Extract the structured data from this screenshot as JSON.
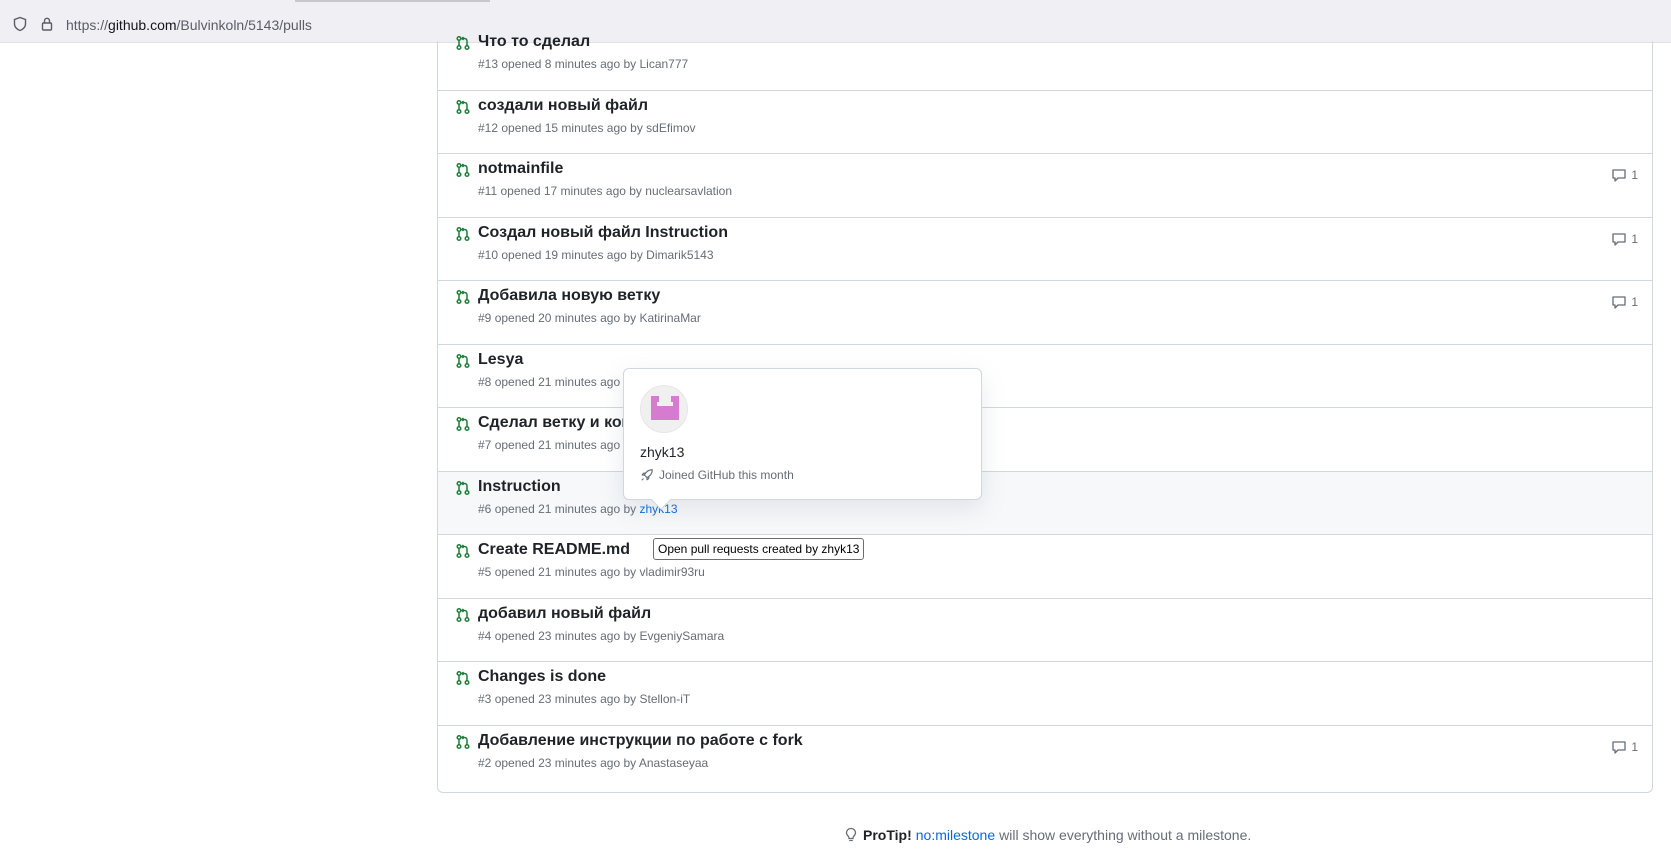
{
  "browser": {
    "url_prefix": "https://",
    "url_domain": "github.com",
    "url_path": "/Bulvinkoln/5143/pulls"
  },
  "pulls": [
    {
      "title": "Что то сделал",
      "number": "#13",
      "opened": "opened 8 minutes ago by",
      "author": "Lican777",
      "comments": ""
    },
    {
      "title": "создали новый файл",
      "number": "#12",
      "opened": "opened 15 minutes ago by",
      "author": "sdEfimov",
      "comments": ""
    },
    {
      "title": "notmainfile",
      "number": "#11",
      "opened": "opened 17 minutes ago by",
      "author": "nuclearsavlation",
      "comments": "1"
    },
    {
      "title": "Создал новый файл Instruction",
      "number": "#10",
      "opened": "opened 19 minutes ago by",
      "author": "Dimarik5143",
      "comments": "1"
    },
    {
      "title": "Добавила новую ветку",
      "number": "#9",
      "opened": "opened 20 minutes ago by",
      "author": "KatirinaMar",
      "comments": "1"
    },
    {
      "title": "Lesya",
      "number": "#8",
      "opened": "opened 21 minutes ago",
      "author": "",
      "comments": ""
    },
    {
      "title": "Сделал ветку и ком",
      "number": "#7",
      "opened": "opened 21 minutes ago",
      "author": "",
      "comments": ""
    },
    {
      "title": "Instruction",
      "number": "#6",
      "opened": "opened 21 minutes ago by",
      "author": "zhyk13",
      "comments": ""
    },
    {
      "title": "Create README.md",
      "number": "#5",
      "opened": "opened 21 minutes ago by",
      "author": "vladimir93ru",
      "comments": ""
    },
    {
      "title": "добавил новый файл",
      "number": "#4",
      "opened": "opened 23 minutes ago by",
      "author": "EvgeniySamara",
      "comments": ""
    },
    {
      "title": "Changes is done",
      "number": "#3",
      "opened": "opened 23 minutes ago by",
      "author": "Stellon-iT",
      "comments": ""
    },
    {
      "title": "Добавление инструкции по работе с fork",
      "number": "#2",
      "opened": "opened 23 minutes ago by",
      "author": "Anastaseyaa",
      "comments": "1"
    }
  ],
  "hovercard": {
    "login": "zhyk13",
    "joined": "Joined GitHub this month"
  },
  "tooltip": "Open pull requests created by zhyk13",
  "protip": {
    "label": "ProTip!",
    "link": "no:milestone",
    "rest": "will show everything without a milestone."
  },
  "colors": {
    "open_green": "#1a7f37",
    "link_blue": "#0969da",
    "muted": "#656d76",
    "avatar_pink": "#d67bd0"
  }
}
